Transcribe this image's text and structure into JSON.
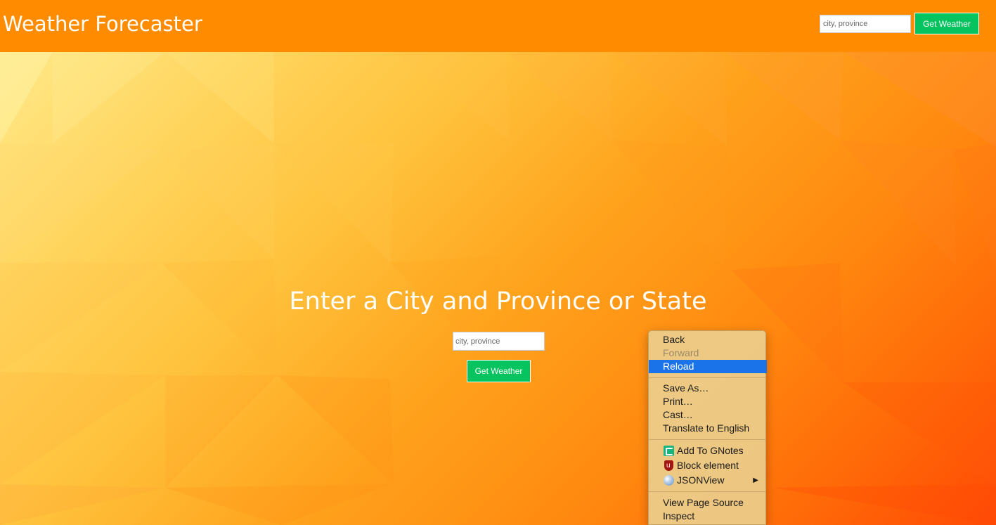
{
  "header": {
    "brand": "Weather Forecaster",
    "search_placeholder": "city, province",
    "button_label": "Get Weather"
  },
  "hero": {
    "title": "Enter a City and Province or State",
    "search_placeholder": "city, province",
    "button_label": "Get Weather"
  },
  "context_menu": {
    "items": [
      {
        "label": "Back",
        "state": "enabled"
      },
      {
        "label": "Forward",
        "state": "disabled"
      },
      {
        "label": "Reload",
        "state": "highlighted"
      },
      {
        "label": "Save As…"
      },
      {
        "label": "Print…"
      },
      {
        "label": "Cast…"
      },
      {
        "label": "Translate to English"
      },
      {
        "label": "Add To GNotes",
        "icon": "gnotes-icon"
      },
      {
        "label": "Block element",
        "icon": "ublock-icon"
      },
      {
        "label": "JSONView",
        "icon": "jsonview-icon",
        "submenu": true
      },
      {
        "label": "View Page Source"
      },
      {
        "label": "Inspect"
      }
    ],
    "submenu_glyph": "▶"
  },
  "colors": {
    "navbar": "#ff8c00",
    "button": "#05c460",
    "menu_highlight": "#1a73e8"
  }
}
